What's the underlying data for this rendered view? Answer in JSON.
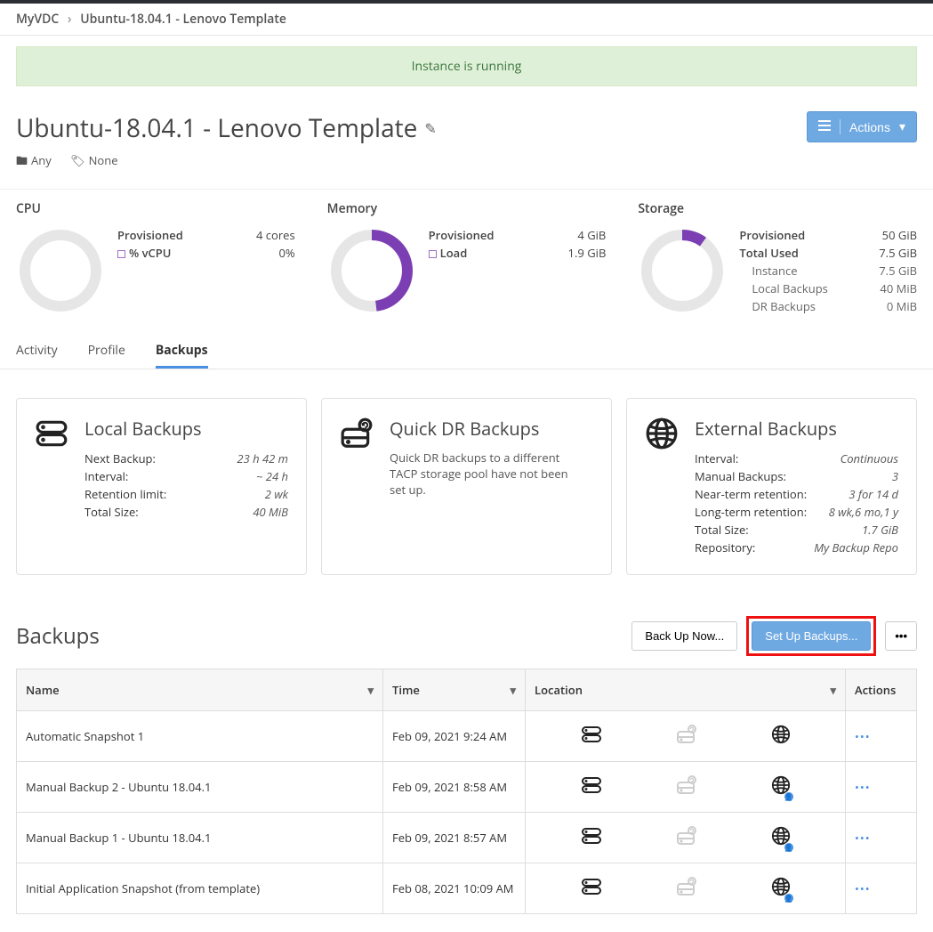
{
  "breadcrumb": {
    "root": "MyVDC",
    "current": "Ubuntu-18.04.1 - Lenovo Template"
  },
  "banner": {
    "text": "Instance is running"
  },
  "page": {
    "title": "Ubuntu-18.04.1 - Lenovo Template"
  },
  "header_actions": {
    "actions_label": "Actions"
  },
  "meta": {
    "folder": "Any",
    "tag": "None"
  },
  "stats": {
    "cpu": {
      "title": "CPU",
      "provisioned_label": "Provisioned",
      "provisioned_value": "4 cores",
      "vcpu_label": "% vCPU",
      "vcpu_value": "0%",
      "donut_percent": 0
    },
    "memory": {
      "title": "Memory",
      "provisioned_label": "Provisioned",
      "provisioned_value": "4 GiB",
      "load_label": "Load",
      "load_value": "1.9 GiB",
      "donut_percent": 48
    },
    "storage": {
      "title": "Storage",
      "provisioned_label": "Provisioned",
      "provisioned_value": "50 GiB",
      "total_used_label": "Total Used",
      "total_used_value": "7.5 GiB",
      "instance_label": "Instance",
      "instance_value": "7.5 GiB",
      "local_label": "Local Backups",
      "local_value": "40 MiB",
      "dr_label": "DR Backups",
      "dr_value": "0 MiB",
      "donut_percent": 10
    }
  },
  "tabs": {
    "t0": "Activity",
    "t1": "Profile",
    "t2": "Backups"
  },
  "cards": {
    "local": {
      "title": "Local Backups",
      "r0k": "Next Backup:",
      "r0v": "23 h 42 m",
      "r1k": "Interval:",
      "r1v": "~ 24 h",
      "r2k": "Retention limit:",
      "r2v": "2 wk",
      "r3k": "Total Size:",
      "r3v": "40 MiB"
    },
    "quickdr": {
      "title": "Quick DR Backups",
      "desc": "Quick DR backups to a different TACP storage pool have not been set up."
    },
    "external": {
      "title": "External Backups",
      "r0k": "Interval:",
      "r0v": "Continuous",
      "r1k": "Manual Backups:",
      "r1v": "3",
      "r2k": "Near-term retention:",
      "r2v": "3 for 14 d",
      "r3k": "Long-term retention:",
      "r3v": "8 wk,6 mo,1 y",
      "r4k": "Total Size:",
      "r4v": "1.7 GiB",
      "r5k": "Repository:",
      "r5v": "My Backup Repo"
    }
  },
  "section": {
    "heading": "Backups",
    "backup_now": "Back Up Now...",
    "setup_backups": "Set Up Backups...",
    "more": "•••"
  },
  "table": {
    "h_name": "Name",
    "h_time": "Time",
    "h_location": "Location",
    "h_actions": "Actions",
    "rows": [
      {
        "name": "Automatic Snapshot 1",
        "time": "Feb 09, 2021 9:24 AM",
        "user_badge": false
      },
      {
        "name": "Manual Backup 2 - Ubuntu 18.04.1",
        "time": "Feb 09, 2021 8:58 AM",
        "user_badge": true
      },
      {
        "name": "Manual Backup 1 - Ubuntu 18.04.1",
        "time": "Feb 09, 2021 8:57 AM",
        "user_badge": true
      },
      {
        "name": "Initial Application Snapshot (from template)",
        "time": "Feb 08, 2021 10:09 AM",
        "user_badge": true
      }
    ]
  },
  "chart_data": [
    {
      "type": "pie",
      "title": "CPU",
      "series": [
        {
          "name": "% vCPU",
          "value": 0,
          "unit": "%"
        }
      ],
      "provisioned": "4 cores"
    },
    {
      "type": "pie",
      "title": "Memory",
      "series": [
        {
          "name": "Load",
          "value": 1.9,
          "unit": "GiB",
          "of": 4
        }
      ],
      "provisioned": "4 GiB"
    },
    {
      "type": "pie",
      "title": "Storage",
      "series": [
        {
          "name": "Total Used",
          "value": 7.5,
          "unit": "GiB",
          "of": 50
        }
      ],
      "breakdown": [
        {
          "name": "Instance",
          "value": "7.5 GiB"
        },
        {
          "name": "Local Backups",
          "value": "40 MiB"
        },
        {
          "name": "DR Backups",
          "value": "0 MiB"
        }
      ],
      "provisioned": "50 GiB"
    }
  ]
}
